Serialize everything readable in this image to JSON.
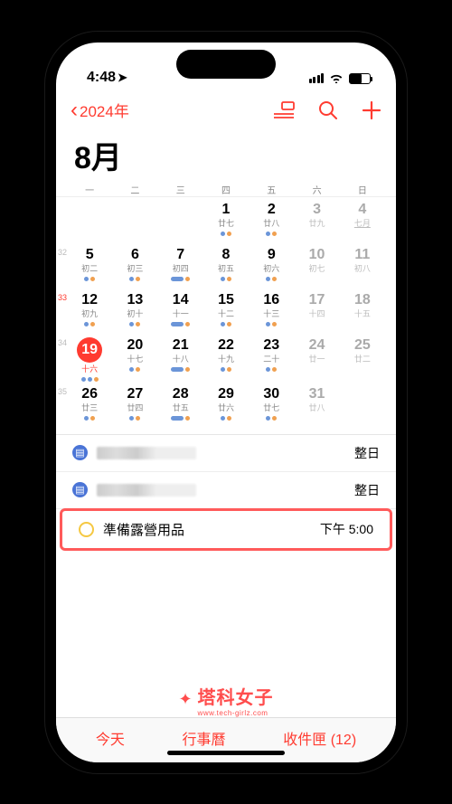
{
  "status": {
    "time": "4:48",
    "loc_arrow": "➤"
  },
  "nav": {
    "back_label": "2024年",
    "icons": {
      "view": "view-mode",
      "search": "search",
      "add": "add"
    }
  },
  "month_title": "8月",
  "weekdays": [
    "一",
    "二",
    "三",
    "四",
    "五",
    "六",
    "日"
  ],
  "weeks": [
    {
      "num": "",
      "days": [
        null,
        null,
        null,
        {
          "n": "1",
          "s": "廿七",
          "dots": [
            "b",
            "o"
          ]
        },
        {
          "n": "2",
          "s": "廿八",
          "dots": [
            "b",
            "o"
          ]
        },
        {
          "n": "3",
          "s": "廿九",
          "weekend": true
        },
        {
          "n": "4",
          "s": "七月",
          "weekend": true,
          "underline": true
        }
      ]
    },
    {
      "num": "32",
      "days": [
        {
          "n": "5",
          "s": "初二",
          "dots": [
            "b",
            "o"
          ]
        },
        {
          "n": "6",
          "s": "初三",
          "dots": [
            "b",
            "o"
          ]
        },
        {
          "n": "7",
          "s": "初四",
          "bars": true
        },
        {
          "n": "8",
          "s": "初五",
          "dots": [
            "b",
            "o"
          ]
        },
        {
          "n": "9",
          "s": "初六",
          "dots": [
            "b",
            "o"
          ]
        },
        {
          "n": "10",
          "s": "初七",
          "weekend": true
        },
        {
          "n": "11",
          "s": "初八",
          "weekend": true
        }
      ]
    },
    {
      "num": "33",
      "current": true,
      "days": [
        {
          "n": "12",
          "s": "初九",
          "dots": [
            "b",
            "o"
          ]
        },
        {
          "n": "13",
          "s": "初十",
          "dots": [
            "b",
            "o"
          ]
        },
        {
          "n": "14",
          "s": "十一",
          "bars": true
        },
        {
          "n": "15",
          "s": "十二",
          "dots": [
            "b",
            "o"
          ]
        },
        {
          "n": "16",
          "s": "十三",
          "dots": [
            "b",
            "o"
          ]
        },
        {
          "n": "17",
          "s": "十四",
          "weekend": true
        },
        {
          "n": "18",
          "s": "十五",
          "weekend": true
        }
      ]
    },
    {
      "num": "34",
      "days": [
        {
          "n": "19",
          "s": "十六",
          "today": true,
          "dots": [
            "b",
            "b",
            "o"
          ]
        },
        {
          "n": "20",
          "s": "十七",
          "dots": [
            "b",
            "o"
          ]
        },
        {
          "n": "21",
          "s": "十八",
          "bars": true
        },
        {
          "n": "22",
          "s": "十九",
          "dots": [
            "b",
            "o"
          ]
        },
        {
          "n": "23",
          "s": "二十",
          "dots": [
            "b",
            "o"
          ]
        },
        {
          "n": "24",
          "s": "廿一",
          "weekend": true
        },
        {
          "n": "25",
          "s": "廿二",
          "weekend": true
        }
      ]
    },
    {
      "num": "35",
      "days": [
        {
          "n": "26",
          "s": "廿三",
          "dots": [
            "b",
            "o"
          ]
        },
        {
          "n": "27",
          "s": "廿四",
          "dots": [
            "b",
            "o"
          ]
        },
        {
          "n": "28",
          "s": "廿五",
          "bars": true
        },
        {
          "n": "29",
          "s": "廿六",
          "dots": [
            "b",
            "o"
          ]
        },
        {
          "n": "30",
          "s": "廿七",
          "dots": [
            "b",
            "o"
          ]
        },
        {
          "n": "31",
          "s": "廿八",
          "weekend": true
        },
        null
      ]
    }
  ],
  "events": [
    {
      "type": "allday",
      "blurred": true,
      "time": "整日"
    },
    {
      "type": "allday",
      "blurred": true,
      "time": "整日"
    },
    {
      "type": "timed",
      "highlight": true,
      "title": "準備露營用品",
      "time": "下午 5:00"
    }
  ],
  "watermark": {
    "main": "塔科女子",
    "sub": "www.tech-girlz.com"
  },
  "tabbar": {
    "today": "今天",
    "calendars": "行事曆",
    "inbox": "收件匣 (12)"
  }
}
